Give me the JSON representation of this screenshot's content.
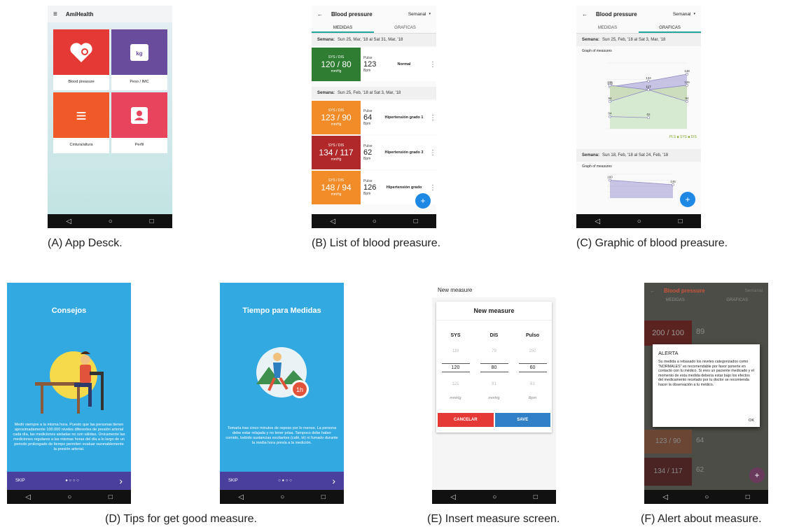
{
  "nav": {
    "back": "◁",
    "home": "○",
    "recent": "□"
  },
  "captions": {
    "a": "(A) App Desck.",
    "b": "(B) List of blood preasure.",
    "c": "(C) Graphic of blood preasure.",
    "d": "(D) Tips for get good measure.",
    "e": "(E) Insert measure screen.",
    "f": "(F) Alert about measure."
  },
  "screen_a": {
    "app_title": "AmiHealth",
    "tiles": [
      {
        "label": "Blood preasure",
        "color": "#e53935"
      },
      {
        "label": "Peso / IMC",
        "color": "#6a4c9c"
      },
      {
        "label": "Cintura/altura",
        "color": "#ef5a28"
      },
      {
        "label": "Perfil",
        "color": "#e8445d"
      }
    ]
  },
  "screen_b": {
    "title": "Blood pressure",
    "period": "Semanal",
    "tab1": "MEDIDAS",
    "tab2": "GRAFICAS",
    "week_label": "Semana:",
    "week1": "Sun 25, Mar, '18 al Sat 31, Mar, '18",
    "week2": "Sun 25, Feb, '18 al Sat 3, Mar, '18",
    "records": [
      {
        "sys_dis_label": "SYS / DIS",
        "value": "120 / 80",
        "unit": "mmHg",
        "pulse_label": "Pulse",
        "pulse": "123",
        "pulse_unit": "Bpm",
        "status": "Normal",
        "color": "#2e7d32"
      },
      {
        "sys_dis_label": "SYS / DIS",
        "value": "123 / 90",
        "unit": "mmHg",
        "pulse_label": "Pulse",
        "pulse": "64",
        "pulse_unit": "Bpm",
        "status": "Hipertensión grado 1",
        "color": "#f28c28"
      },
      {
        "sys_dis_label": "SYS / DIS",
        "value": "134 / 117",
        "unit": "mmHg",
        "pulse_label": "Pulse",
        "pulse": "62",
        "pulse_unit": "Bpm",
        "status": "Hipertensión grado 3",
        "color": "#b0282a"
      },
      {
        "sys_dis_label": "SYS / DIS",
        "value": "148 / 94",
        "unit": "mmHg",
        "pulse_label": "Pulse",
        "pulse": "126",
        "pulse_unit": "Bpm",
        "status": "Hipertensión grado",
        "color": "#f28c28"
      }
    ],
    "fab": "+"
  },
  "screen_c": {
    "title": "Blood pressure",
    "period": "Semanal",
    "tab1": "MEDIDAS",
    "tab2": "GRAFICAS",
    "week_label": "Semana:",
    "week1": "Sun 25, Feb, '18 al Sat 3, Mar, '18",
    "week2": "Sun 18, Feb, '18 al Sat 24, Feb, '18",
    "graph_label": "Graph of measures",
    "legend": "PLS ■ SYS ■ DIS",
    "fab": "+"
  },
  "chart_data": [
    {
      "type": "area",
      "title": "Graph of measures",
      "categories": [
        "1",
        "2",
        "3"
      ],
      "series": [
        {
          "name": "SYS",
          "values": [
            123,
            134,
            148
          ]
        },
        {
          "name": "PLS",
          "values": [
            126,
            117,
            126
          ]
        },
        {
          "name": "DIS",
          "values": [
            94,
            117,
            94
          ]
        },
        {
          "name": "",
          "values": [
            64,
            62,
            null
          ]
        }
      ],
      "ylim": [
        40,
        170
      ]
    },
    {
      "type": "area",
      "title": "Graph of measures",
      "categories": [
        "1",
        "2"
      ],
      "series": [
        {
          "name": "SYS",
          "values": [
            160,
            145
          ]
        }
      ],
      "ylim": [
        100,
        180
      ]
    }
  ],
  "screen_d1": {
    "title": "Consejos",
    "body": "Medir siempre a la misma hora. Puesto que las personas tienen aproximadamente 100.000 niveles diferentes de presión arterial cada día, las mediciones aisladas no son válidas. Únicamente las mediciones regulares a las mismas horas del día a lo largo de un periodo prolongado de tiempo permiten evaluar razonablemente la presión arterial.",
    "skip": "SKIP",
    "next": "›"
  },
  "screen_d2": {
    "title": "Tiempo para Medidas",
    "body": "Tomarla tras cinco minutos de reposo por lo menos. La persona debe estar relajada y no tener prisa. Tampoco debe haber comido, bebido sustancias excitantes (café, té) ni fumado durante la media hora previa a la medición.",
    "skip": "SKIP",
    "next": "›"
  },
  "screen_e": {
    "header": "New measure",
    "dialog_title": "New measure",
    "cols": [
      "SYS",
      "DIS",
      "Pulso"
    ],
    "prev": [
      "119",
      "79",
      "250"
    ],
    "current": [
      "120",
      "80",
      "60"
    ],
    "next": [
      "121",
      "81",
      "61"
    ],
    "units": [
      "mmHg",
      "mmHg",
      "Bpm"
    ],
    "cancel": "CANCELAR",
    "save": "SAVE"
  },
  "screen_f": {
    "title": "Blood pressure",
    "period": "Semanal",
    "tab1": "MEDIDAS",
    "tab2": "GRAFICAS",
    "rec1": "200 / 100",
    "rec1_pulse": "89",
    "rec3": "123 / 90",
    "rec3_pulse": "64",
    "rec4": "134 / 117",
    "rec4_pulse": "62",
    "alert_title": "ALERTA",
    "alert_body": "Su medida a rebasado los niveles categorizados como \"NORMALES\" es recomendable por favor ponerte en contacto con tu médico. Si eres un paciente medicado y el momento de esta medida debería estar bajo los efectos del medicamento recetado por tu doctor se recomienda hacer la observación a tu médico.",
    "ok": "OK"
  }
}
